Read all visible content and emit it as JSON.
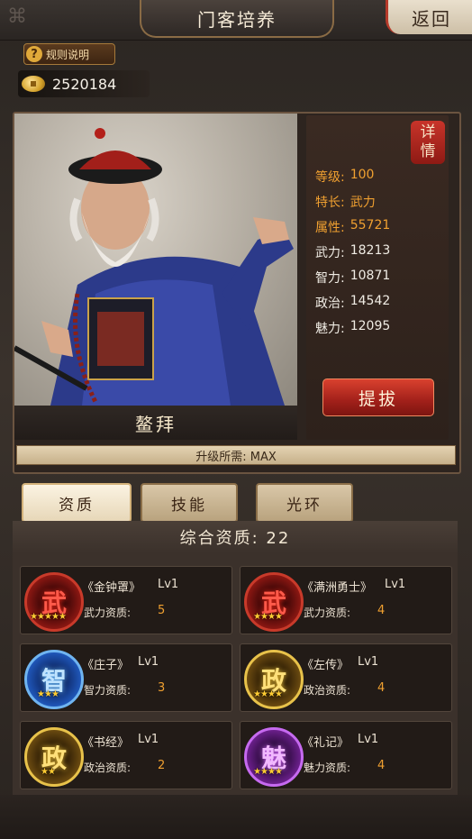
{
  "header": {
    "title": "门客培养",
    "back_label": "返回"
  },
  "rules_label": "规则说明",
  "coins": "2520184",
  "hero": {
    "name": "鳌拜",
    "detail_label": [
      "详",
      "情"
    ],
    "stats": [
      {
        "key": "等级:",
        "value": "100"
      },
      {
        "key": "特长:",
        "value": "武力"
      },
      {
        "key": "属性:",
        "value": "55721"
      },
      {
        "key": "武力:",
        "value": "18213"
      },
      {
        "key": "智力:",
        "value": "10871"
      },
      {
        "key": "政治:",
        "value": "14542"
      },
      {
        "key": "魅力:",
        "value": "12095"
      }
    ],
    "promote_label": "提拔",
    "upgrade_text": "升级所需: MAX"
  },
  "tabs": [
    "资质",
    "技能",
    "光环"
  ],
  "qualification_header": "综合资质: 22",
  "skills": [
    {
      "glyph": "武",
      "stars": "★★★★★",
      "name": "《金钟罩》",
      "level": "Lv1",
      "label": "武力资质:",
      "value": "5"
    },
    {
      "glyph": "武",
      "stars": "★★★★",
      "name": "《满洲勇士》",
      "level": "Lv1",
      "label": "武力资质:",
      "value": "4"
    },
    {
      "glyph": "智",
      "stars": "★★★",
      "name": "《庄子》",
      "level": "Lv1",
      "label": "智力资质:",
      "value": "3"
    },
    {
      "glyph": "政",
      "stars": "★★★★",
      "name": "《左传》",
      "level": "Lv1",
      "label": "政治资质:",
      "value": "4"
    },
    {
      "glyph": "政",
      "stars": "★★",
      "name": "《书经》",
      "level": "Lv1",
      "label": "政治资质:",
      "value": "2"
    },
    {
      "glyph": "魅",
      "stars": "★★★★",
      "name": "《礼记》",
      "level": "Lv1",
      "label": "魅力资质:",
      "value": "4"
    }
  ]
}
